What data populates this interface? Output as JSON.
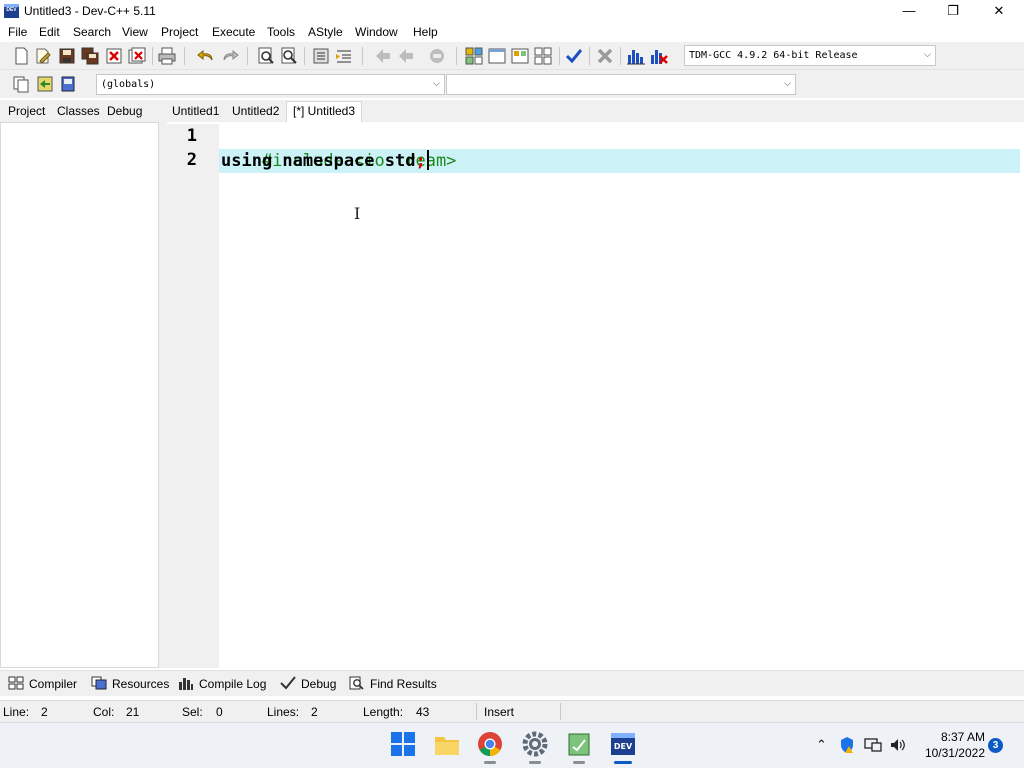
{
  "window": {
    "title": "Untitled3 - Dev-C++ 5.11",
    "icon_label": "DEV",
    "minimize_glyph": "—",
    "maximize_glyph": "❐",
    "close_glyph": "✕"
  },
  "menu": [
    "File",
    "Edit",
    "Search",
    "View",
    "Project",
    "Execute",
    "Tools",
    "AStyle",
    "Window",
    "Help"
  ],
  "toolbar": {
    "compiler_select": "TDM-GCC 4.9.2 64-bit Release",
    "scope_select": "(globals)",
    "member_select": ""
  },
  "side_tabs": [
    "Project",
    "Classes",
    "Debug"
  ],
  "editor_tabs": [
    "Untitled1",
    "Untitled2",
    "[*] Untitled3"
  ],
  "editor": {
    "line_numbers": [
      "1",
      "2"
    ],
    "line1": "#include <iostream>",
    "line2_kw": "using namespace std",
    "line2_sym": ";"
  },
  "bottom_tabs": [
    "Compiler",
    "Resources",
    "Compile Log",
    "Debug",
    "Find Results"
  ],
  "status": {
    "line_label": "Line:",
    "line_value": "2",
    "col_label": "Col:",
    "col_value": "21",
    "sel_label": "Sel:",
    "sel_value": "0",
    "lines_label": "Lines:",
    "lines_value": "2",
    "length_label": "Length:",
    "length_value": "43",
    "mode": "Insert"
  },
  "taskbar": {
    "time": "8:37 AM",
    "date": "10/31/2022",
    "notification_count": "3"
  },
  "colors": {
    "preprocessor": "#1a8a1a",
    "symbol": "#e00000",
    "current_line": "#ccf2f8",
    "accent": "#0a5bc4"
  }
}
